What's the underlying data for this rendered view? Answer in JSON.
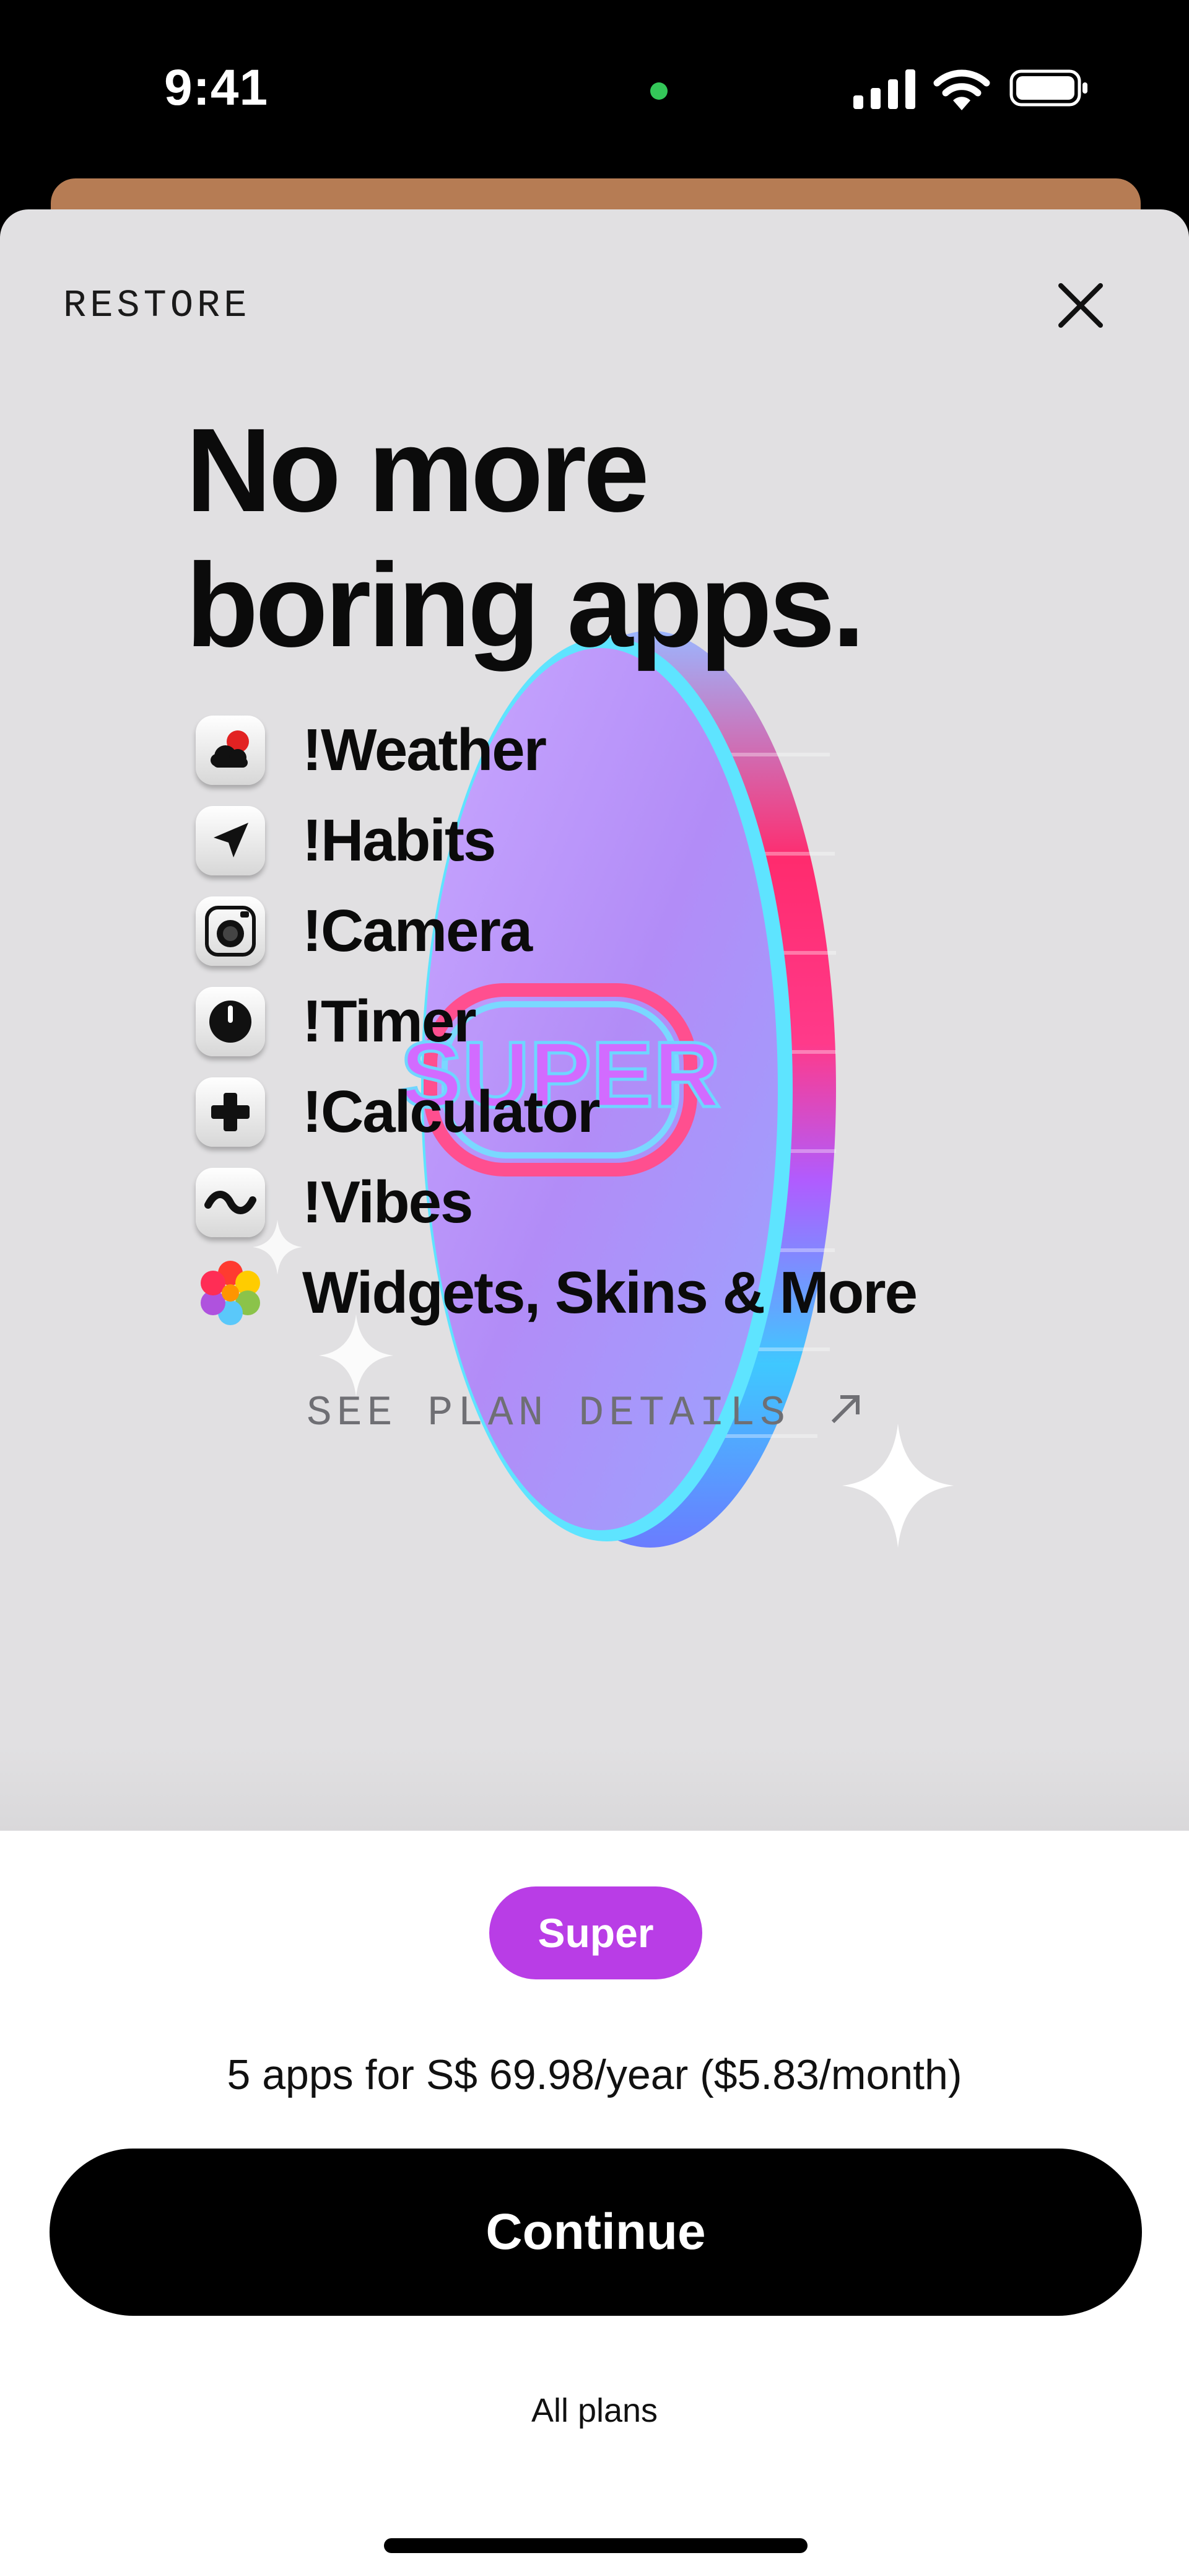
{
  "status_bar": {
    "time": "9:41",
    "indicator_color": "#34c759"
  },
  "header": {
    "restore_label": "RESTORE",
    "close_icon": "close-icon"
  },
  "headline": {
    "line1": "No more",
    "line2": "boring apps."
  },
  "features": [
    {
      "icon": "weather-icon",
      "label": "!Weather"
    },
    {
      "icon": "habits-arrow-icon",
      "label": "!Habits"
    },
    {
      "icon": "camera-icon",
      "label": "!Camera"
    },
    {
      "icon": "timer-icon",
      "label": "!Timer"
    },
    {
      "icon": "calculator-plus-icon",
      "label": "!Calculator"
    },
    {
      "icon": "vibes-wave-icon",
      "label": "!Vibes"
    },
    {
      "icon": "flower-icon",
      "label": "Widgets, Skins & More"
    }
  ],
  "plan_details": {
    "label": "SEE PLAN DETAILS",
    "icon": "arrow-up-right-icon"
  },
  "coin": {
    "text": "SUPER"
  },
  "plan": {
    "badge": "Super",
    "badge_color": "#b93de6",
    "price_text": "5 apps for S$ 69.98/year ($5.83/month)",
    "continue_label": "Continue",
    "all_plans_label": "All plans"
  },
  "colors": {
    "sheet_bg": "#e1e0e2",
    "peek_card": "#b67c54",
    "button_bg": "#000000"
  }
}
